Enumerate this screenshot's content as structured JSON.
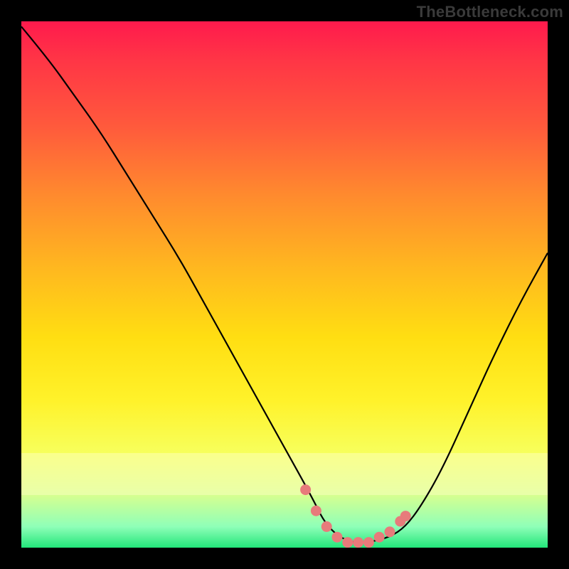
{
  "watermark": "TheBottleneck.com",
  "colors": {
    "frame": "#000000",
    "curve": "#000000",
    "marker": "#e77b7b",
    "grad_top": "#ff1a4d",
    "grad_bottom": "#22e67a"
  },
  "chart_data": {
    "type": "line",
    "title": "",
    "xlabel": "",
    "ylabel": "",
    "xlim": [
      0,
      100
    ],
    "ylim": [
      0,
      100
    ],
    "grid": false,
    "series": [
      {
        "name": "bottleneck-curve",
        "x": [
          0,
          5,
          10,
          15,
          20,
          25,
          30,
          35,
          40,
          45,
          50,
          55,
          58,
          62,
          66,
          70,
          73,
          76,
          80,
          85,
          90,
          95,
          100
        ],
        "y": [
          99,
          93,
          86,
          79,
          71,
          63,
          55,
          46,
          37,
          28,
          19,
          10,
          4,
          1,
          1,
          2,
          4,
          8,
          15,
          26,
          37,
          47,
          56
        ]
      }
    ],
    "markers": {
      "name": "highlighted-range",
      "color": "#e77b7b",
      "x": [
        54,
        56,
        58,
        60,
        62,
        64,
        66,
        68,
        70,
        72,
        73
      ],
      "y": [
        11,
        7,
        4,
        2,
        1,
        1,
        1,
        2,
        3,
        5,
        6
      ]
    },
    "note": "x/y are percentages of plot area; y is curve height from bottom (0 = bottom, 100 = top). Curve estimated from pixels — no axes or tick labels present in source image."
  }
}
